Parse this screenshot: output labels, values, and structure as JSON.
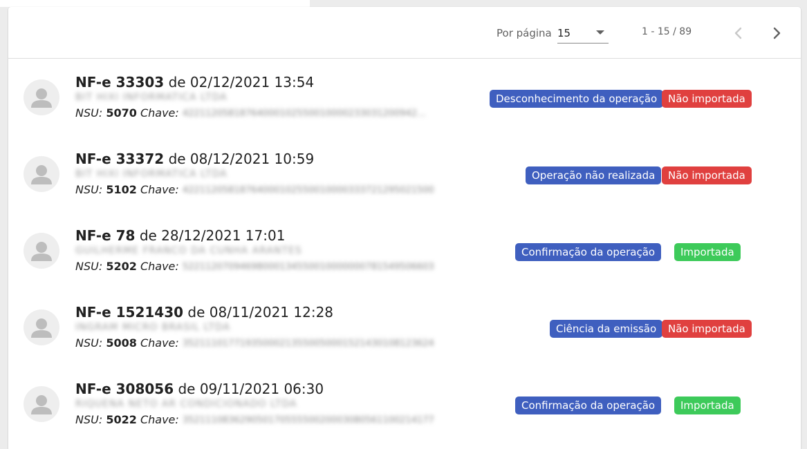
{
  "pagination": {
    "per_page_label": "Por página",
    "per_page_value": "15",
    "range_text": "1 - 15 / 89",
    "prev_icon": "chevron-left-icon",
    "next_icon": "chevron-right-icon"
  },
  "documents": [
    {
      "number": "NF-e 33303",
      "date_text": "de 02/12/2021 13:54",
      "company": "BIT HIXI INFORMATICA LTDA",
      "nsu_label": "NSU:",
      "nsu": "5070",
      "key_label": "Chave:",
      "key": "42211205818764000102550010000233031200942…",
      "status_event": "Desconhecimento da operação",
      "status_import": "Não importada"
    },
    {
      "number": "NF-e 33372",
      "date_text": "de 08/12/2021 10:59",
      "company": "BIT HIXI INFORMATICA LTDA",
      "nsu_label": "NSU:",
      "nsu": "5102",
      "key_label": "Chave:",
      "key": "42211205818764000102550010000333721295021500",
      "status_event": "Operação não realizada",
      "status_import": "Não importada"
    },
    {
      "number": "NF-e 78",
      "date_text": "de 28/12/2021 17:01",
      "company": "GUILHERME FRANCO DA CUNHA ARANTES",
      "nsu_label": "NSU:",
      "nsu": "5202",
      "key_label": "Chave:",
      "key": "52211207094698000134550010000000781549506603",
      "status_event": "Confirmação da operação",
      "status_import": "Importada"
    },
    {
      "number": "NF-e 1521430",
      "date_text": "de 08/11/2021 12:28",
      "company": "INGRAM MICRO BRASIL LTDA",
      "nsu_label": "NSU:",
      "nsu": "5008",
      "key_label": "Chave:",
      "key": "35211101771935000213550050001521430108123624",
      "status_event": "Ciência da emissão",
      "status_import": "Não importada"
    },
    {
      "number": "NF-e 308056",
      "date_text": "de 09/11/2021 06:30",
      "company": "RIQUENA NETO AR CONDICIONADO LTDA",
      "nsu_label": "NSU:",
      "nsu": "5022",
      "key_label": "Chave:",
      "key": "35211108362905017055550020003080561100214177",
      "status_event": "Confirmação da operação",
      "status_import": "Importada"
    }
  ],
  "colors": {
    "event_chip": "#3f5fbf",
    "not_imported_chip": "#e0403f",
    "imported_chip": "#3dca5a"
  }
}
